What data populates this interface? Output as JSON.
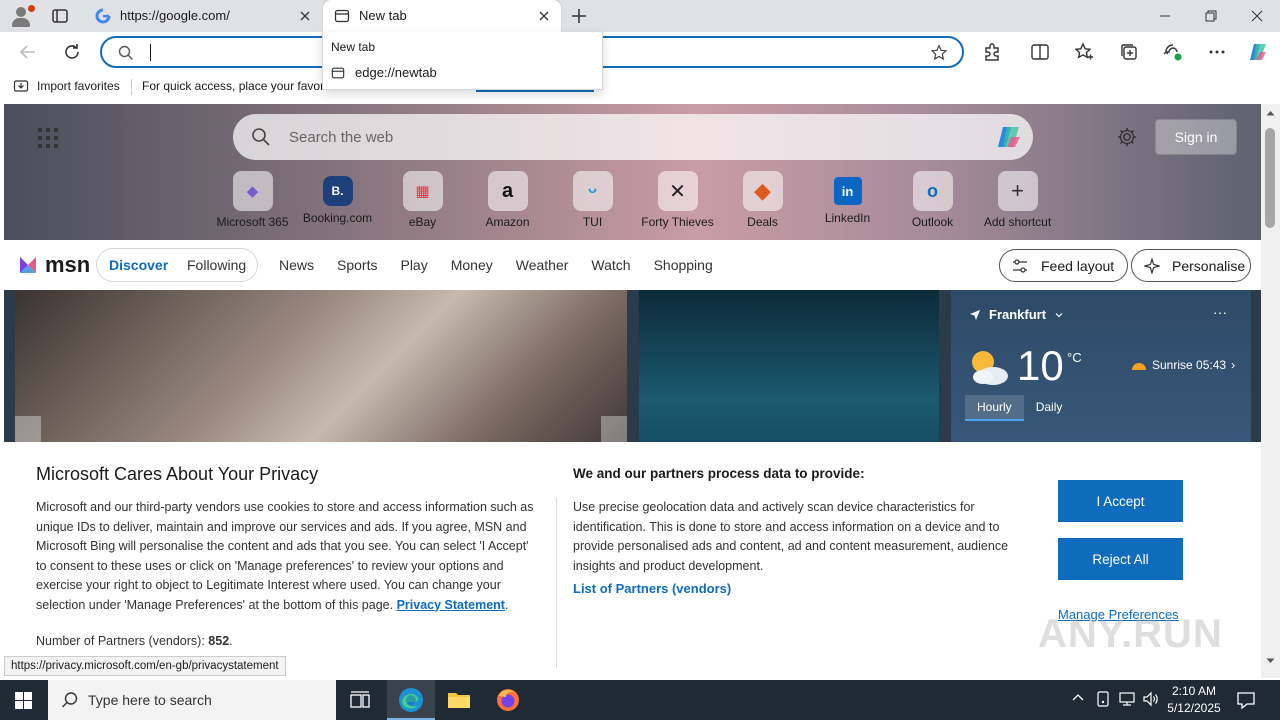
{
  "browser": {
    "tabs": [
      {
        "title": "https://google.com/",
        "active": false
      },
      {
        "title": "New tab",
        "active": true
      }
    ],
    "dropdown": {
      "header": "New tab",
      "suggestion": "edge://newtab"
    },
    "favorites_bar": {
      "import": "Import favorites",
      "hint": "For quick access, place your favori"
    },
    "status_url": "https://privacy.microsoft.com/en-gb/privacystatement"
  },
  "newtab": {
    "search_placeholder": "Search the web",
    "sign_in": "Sign in",
    "shortcuts": [
      {
        "label": "Microsoft 365",
        "glyph": "◆",
        "color": "#7a5bd6"
      },
      {
        "label": "Booking.com",
        "glyph": "B.",
        "color": "#1d3f7c"
      },
      {
        "label": "eBay",
        "glyph": "▦",
        "color": "#e53238"
      },
      {
        "label": "Amazon",
        "glyph": "a",
        "color": "#111111"
      },
      {
        "label": "TUI",
        "glyph": "ᵕ",
        "color": "#1ba1e2"
      },
      {
        "label": "Forty Thieves",
        "glyph": "✕",
        "color": "#222222"
      },
      {
        "label": "Deals",
        "glyph": "◆",
        "color": "#e05a1c"
      },
      {
        "label": "LinkedIn",
        "glyph": "in",
        "color": "#0a66c2"
      },
      {
        "label": "Outlook",
        "glyph": "o",
        "color": "#0f6cbd"
      },
      {
        "label": "Add shortcut",
        "glyph": "+",
        "color": "#333333"
      }
    ]
  },
  "msn": {
    "logo": "msn",
    "tabs": {
      "discover": "Discover",
      "following": "Following"
    },
    "nav": [
      "News",
      "Sports",
      "Play",
      "Money",
      "Weather",
      "Watch",
      "Shopping"
    ],
    "feed_layout": "Feed layout",
    "personalise": "Personalise",
    "weather": {
      "location": "Frankfurt",
      "temp": "10",
      "unit": "°C",
      "sunrise": "Sunrise 05:43",
      "tab_hourly": "Hourly",
      "tab_daily": "Daily"
    }
  },
  "privacy": {
    "title": "Microsoft Cares About Your Privacy",
    "body": "Microsoft and our third-party vendors use cookies to store and access information such as unique IDs to deliver, maintain and improve our services and ads. If you agree, MSN and Microsoft Bing will personalise the content and ads that you see. You can select 'I Accept' to consent to these uses or click on 'Manage preferences' to review your options and exercise your right to object to Legitimate Interest where used.  You can change your selection under 'Manage Preferences' at the bottom of this page.",
    "privacy_link": "Privacy Statement",
    "partners_count_label": "Number of Partners (vendors): ",
    "partners_count": "852",
    "right_title": "We and our partners process data to provide:",
    "right_body": "Use precise geolocation data and actively scan device characteristics for identification. This is done to store and access information on a device and to provide personalised ads and content, ad and content measurement, audience insights and product development.",
    "partners_link": "List of Partners (vendors)",
    "accept": "I Accept",
    "reject": "Reject All",
    "manage": "Manage Preferences"
  },
  "watermark": "ANY.RUN",
  "taskbar": {
    "search_placeholder": "Type here to search",
    "time": "2:10 AM",
    "date": "5/12/2025"
  },
  "colors": {
    "accent": "#0f6cbd",
    "taskbar": "#1f2a35"
  }
}
